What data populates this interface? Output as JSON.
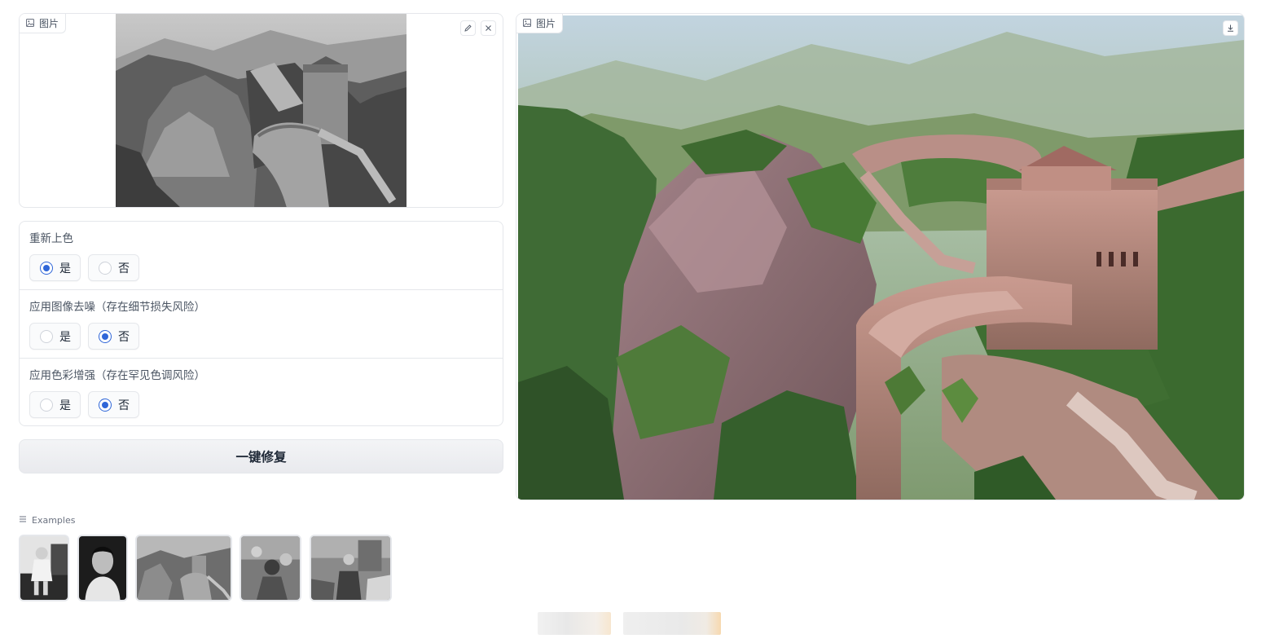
{
  "input_image": {
    "label": "图片",
    "icon": "image-icon",
    "edit_icon": "pencil-icon",
    "clear_icon": "close-icon"
  },
  "options": [
    {
      "title": "重新上色",
      "choices": [
        {
          "label": "是",
          "selected": true
        },
        {
          "label": "否",
          "selected": false
        }
      ]
    },
    {
      "title": "应用图像去噪（存在细节损失风险）",
      "choices": [
        {
          "label": "是",
          "selected": false
        },
        {
          "label": "否",
          "selected": true
        }
      ]
    },
    {
      "title": "应用色彩增强（存在罕见色调风险）",
      "choices": [
        {
          "label": "是",
          "selected": false
        },
        {
          "label": "否",
          "selected": true
        }
      ]
    }
  ],
  "fix_button": {
    "label": "一键修复"
  },
  "examples": {
    "label": "Examples",
    "icon": "list-icon",
    "items": [
      {
        "name": "example-child-portrait"
      },
      {
        "name": "example-man-portrait"
      },
      {
        "name": "example-great-wall"
      },
      {
        "name": "example-street-scene"
      },
      {
        "name": "example-group-photo"
      }
    ]
  },
  "output_image": {
    "label": "图片",
    "icon": "image-icon",
    "download_icon": "download-icon"
  },
  "colors": {
    "accent": "#2f66d8",
    "border": "#e5e7eb",
    "button_bg": "#eceef1"
  }
}
